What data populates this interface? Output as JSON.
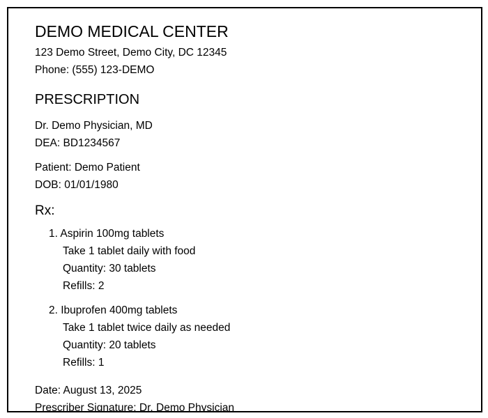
{
  "header": {
    "name": "DEMO MEDICAL CENTER",
    "address": "123 Demo Street, Demo City, DC 12345",
    "phone": "Phone: (555) 123-DEMO"
  },
  "title": "PRESCRIPTION",
  "prescriber": {
    "name": "Dr. Demo Physician, MD",
    "dea": "DEA: BD1234567"
  },
  "patient": {
    "name": "Patient: Demo Patient",
    "dob": "DOB: 01/01/1980"
  },
  "rx_label": "Rx:",
  "medications": [
    {
      "name": "1. Aspirin 100mg tablets",
      "directions": "Take 1 tablet daily with food",
      "quantity": "Quantity: 30 tablets",
      "refills": "Refills: 2"
    },
    {
      "name": "2. Ibuprofen 400mg tablets",
      "directions": "Take 1 tablet twice daily as needed",
      "quantity": "Quantity: 20 tablets",
      "refills": "Refills: 1"
    }
  ],
  "footer": {
    "date": "Date: August 13, 2025",
    "signature": "Prescriber Signature: Dr. Demo Physician"
  }
}
